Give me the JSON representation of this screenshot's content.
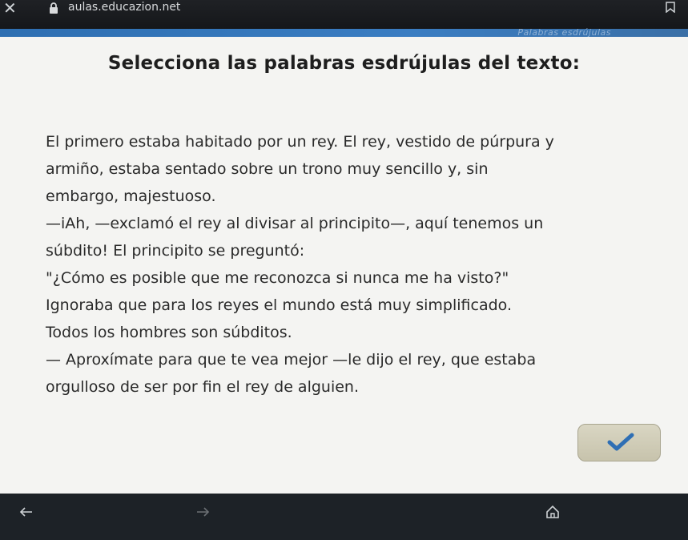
{
  "browser": {
    "url": "aulas.educazion.net"
  },
  "page": {
    "header_ghost_text": "Palabras esdrújulas",
    "title": "Selecciona las palabras esdrújulas del texto:",
    "passage_lines": [
      "El primero estaba habitado por un rey. El rey, vestido de púrpura y",
      "armiño, estaba sentado sobre un trono muy sencillo y, sin",
      "embargo, majestuoso.",
      "—iAh, —exclamó el rey al divisar al principito—, aquí tenemos un",
      "súbdito! El principito se preguntó:",
      "\"¿Cómo es posible que me reconozca si nunca me ha visto?\"",
      "Ignoraba que para los reyes el mundo está muy simplificado.",
      "Todos los hombres son súbditos.",
      "— Aproxímate para que te vea mejor —le dijo el rey, que estaba",
      "orgulloso de ser por fin el rey de alguien."
    ],
    "check_icon": "checkmark-icon"
  },
  "colors": {
    "accent_blue": "#3a7dc2",
    "page_bg": "#f4f4f2",
    "check_color": "#2f6fb4"
  }
}
